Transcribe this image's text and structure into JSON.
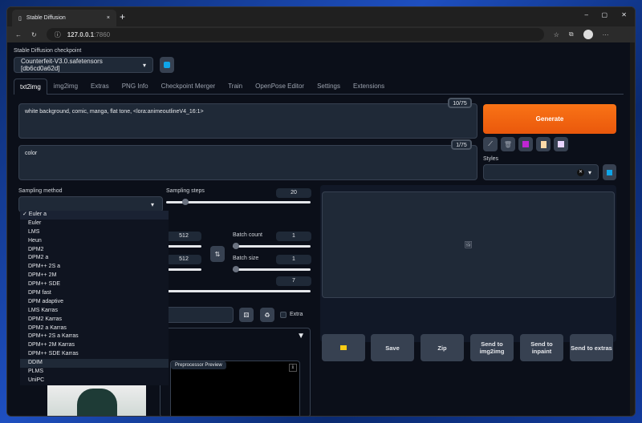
{
  "browser": {
    "tab_title": "Stable Diffusion",
    "url_host": "127.0.0.1",
    "url_port": ":7860"
  },
  "checkpoint": {
    "label": "Stable Diffusion checkpoint",
    "value": "Counterfeit-V3.0.safetensors [db6cd0a62d]"
  },
  "tabs": [
    "txt2img",
    "img2img",
    "Extras",
    "PNG Info",
    "Checkpoint Merger",
    "Train",
    "OpenPose Editor",
    "Settings",
    "Extensions"
  ],
  "prompt": {
    "value": "white background, comic, manga, flat tone,  <lora:animeoutlineV4_16:1>",
    "counter": "10/75"
  },
  "negative": {
    "value": "color",
    "counter": "1/75"
  },
  "generate": "Generate",
  "styles_label": "Styles",
  "sampling": {
    "label": "Sampling method",
    "options": [
      "Euler a",
      "Euler",
      "LMS",
      "Heun",
      "DPM2",
      "DPM2 a",
      "DPM++ 2S a",
      "DPM++ 2M",
      "DPM++ SDE",
      "DPM fast",
      "DPM adaptive",
      "LMS Karras",
      "DPM2 Karras",
      "DPM2 a Karras",
      "DPM++ 2S a Karras",
      "DPM++ 2M Karras",
      "DPM++ SDE Karras",
      "DDIM",
      "PLMS",
      "UniPC"
    ],
    "selected": "Euler a",
    "hovered": "DDIM"
  },
  "steps": {
    "label": "Sampling steps",
    "value": "20"
  },
  "width": "512",
  "height": "512",
  "batch_count": {
    "label": "Batch count",
    "value": "1"
  },
  "batch_size": {
    "label": "Batch size",
    "value": "1"
  },
  "cfg": "7",
  "extra_label": "Extra",
  "preprocessor_label": "Preprocessor Preview",
  "output_buttons": [
    "Save",
    "Zip",
    "Send to img2img",
    "Send to inpaint",
    "Send to extras"
  ],
  "colors": {
    "accent": "#f97316"
  }
}
